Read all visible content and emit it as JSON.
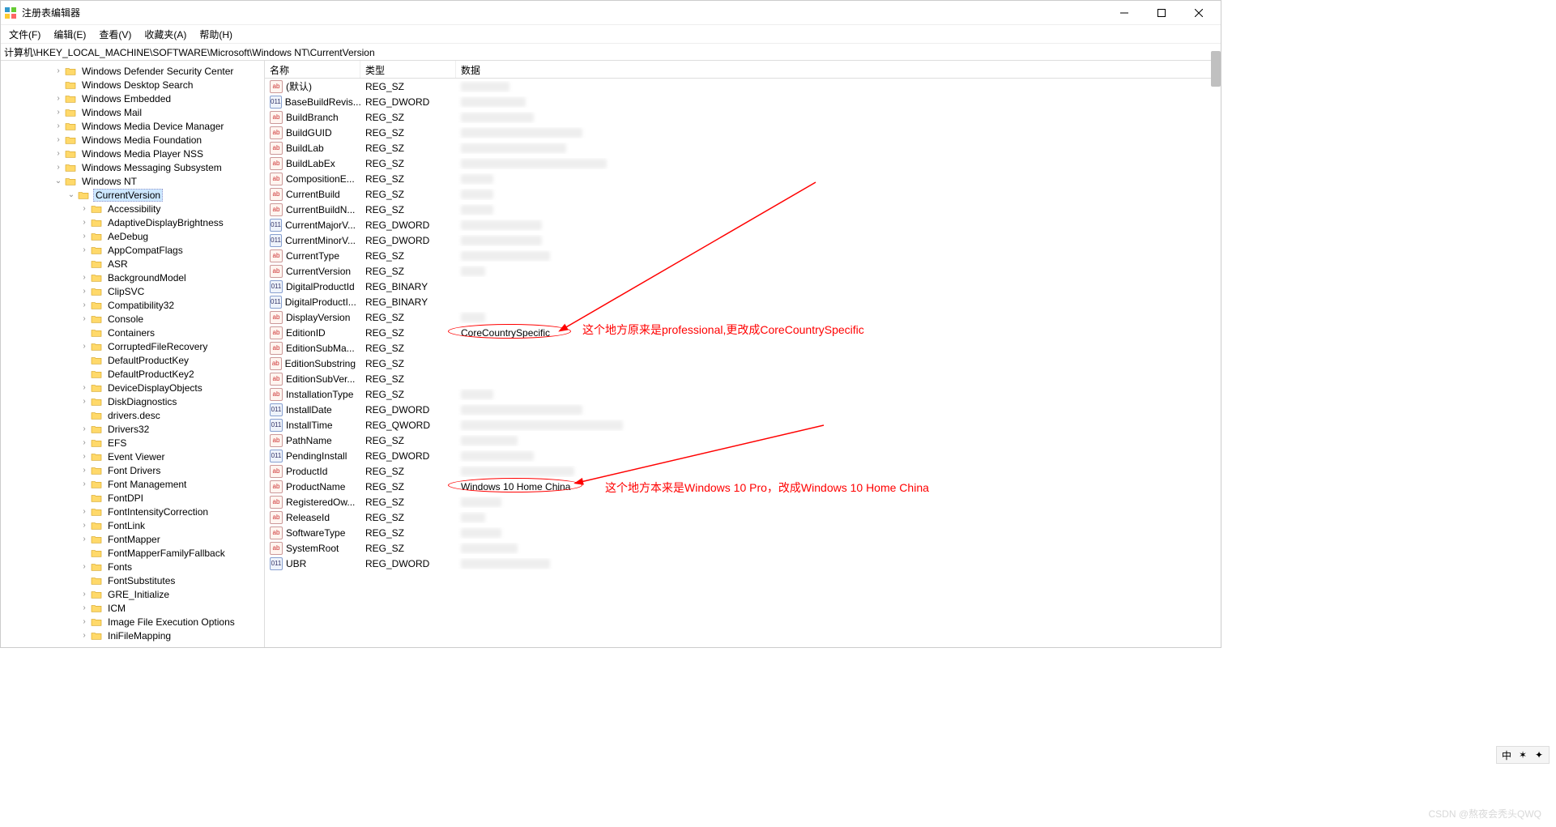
{
  "title": "注册表编辑器",
  "menu": {
    "file": "文件(F)",
    "edit": "编辑(E)",
    "view": "查看(V)",
    "fav": "收藏夹(A)",
    "help": "帮助(H)"
  },
  "address": "计算机\\HKEY_LOCAL_MACHINE\\SOFTWARE\\Microsoft\\Windows NT\\CurrentVersion",
  "list_header": {
    "name": "名称",
    "type": "类型",
    "data": "数据"
  },
  "tree": [
    {
      "indent": 4,
      "chev": ">",
      "label": "Windows Defender Security Center"
    },
    {
      "indent": 4,
      "chev": "",
      "label": "Windows Desktop Search"
    },
    {
      "indent": 4,
      "chev": ">",
      "label": "Windows Embedded"
    },
    {
      "indent": 4,
      "chev": ">",
      "label": "Windows Mail"
    },
    {
      "indent": 4,
      "chev": ">",
      "label": "Windows Media Device Manager"
    },
    {
      "indent": 4,
      "chev": ">",
      "label": "Windows Media Foundation"
    },
    {
      "indent": 4,
      "chev": ">",
      "label": "Windows Media Player NSS"
    },
    {
      "indent": 4,
      "chev": ">",
      "label": "Windows Messaging Subsystem"
    },
    {
      "indent": 4,
      "chev": "v",
      "label": "Windows NT"
    },
    {
      "indent": 5,
      "chev": "v",
      "label": "CurrentVersion",
      "selected": true
    },
    {
      "indent": 6,
      "chev": ">",
      "label": "Accessibility"
    },
    {
      "indent": 6,
      "chev": ">",
      "label": "AdaptiveDisplayBrightness"
    },
    {
      "indent": 6,
      "chev": ">",
      "label": "AeDebug"
    },
    {
      "indent": 6,
      "chev": ">",
      "label": "AppCompatFlags"
    },
    {
      "indent": 6,
      "chev": "",
      "label": "ASR"
    },
    {
      "indent": 6,
      "chev": ">",
      "label": "BackgroundModel"
    },
    {
      "indent": 6,
      "chev": ">",
      "label": "ClipSVC"
    },
    {
      "indent": 6,
      "chev": ">",
      "label": "Compatibility32"
    },
    {
      "indent": 6,
      "chev": ">",
      "label": "Console"
    },
    {
      "indent": 6,
      "chev": "",
      "label": "Containers"
    },
    {
      "indent": 6,
      "chev": ">",
      "label": "CorruptedFileRecovery"
    },
    {
      "indent": 6,
      "chev": "",
      "label": "DefaultProductKey"
    },
    {
      "indent": 6,
      "chev": "",
      "label": "DefaultProductKey2"
    },
    {
      "indent": 6,
      "chev": ">",
      "label": "DeviceDisplayObjects"
    },
    {
      "indent": 6,
      "chev": ">",
      "label": "DiskDiagnostics"
    },
    {
      "indent": 6,
      "chev": "",
      "label": "drivers.desc"
    },
    {
      "indent": 6,
      "chev": ">",
      "label": "Drivers32"
    },
    {
      "indent": 6,
      "chev": ">",
      "label": "EFS"
    },
    {
      "indent": 6,
      "chev": ">",
      "label": "Event Viewer"
    },
    {
      "indent": 6,
      "chev": ">",
      "label": "Font Drivers"
    },
    {
      "indent": 6,
      "chev": ">",
      "label": "Font Management"
    },
    {
      "indent": 6,
      "chev": "",
      "label": "FontDPI"
    },
    {
      "indent": 6,
      "chev": ">",
      "label": "FontIntensityCorrection"
    },
    {
      "indent": 6,
      "chev": ">",
      "label": "FontLink"
    },
    {
      "indent": 6,
      "chev": ">",
      "label": "FontMapper"
    },
    {
      "indent": 6,
      "chev": "",
      "label": "FontMapperFamilyFallback"
    },
    {
      "indent": 6,
      "chev": ">",
      "label": "Fonts"
    },
    {
      "indent": 6,
      "chev": "",
      "label": "FontSubstitutes"
    },
    {
      "indent": 6,
      "chev": ">",
      "label": "GRE_Initialize"
    },
    {
      "indent": 6,
      "chev": ">",
      "label": "ICM"
    },
    {
      "indent": 6,
      "chev": ">",
      "label": "Image File Execution Options"
    },
    {
      "indent": 6,
      "chev": ">",
      "label": "IniFileMapping"
    }
  ],
  "values": [
    {
      "icon": "sz",
      "name": "(默认)",
      "type": "REG_SZ",
      "blur": 60
    },
    {
      "icon": "bin",
      "name": "BaseBuildRevis...",
      "type": "REG_DWORD",
      "blur": 80
    },
    {
      "icon": "sz",
      "name": "BuildBranch",
      "type": "REG_SZ",
      "blur": 90
    },
    {
      "icon": "sz",
      "name": "BuildGUID",
      "type": "REG_SZ",
      "blur": 150
    },
    {
      "icon": "sz",
      "name": "BuildLab",
      "type": "REG_SZ",
      "blur": 130
    },
    {
      "icon": "sz",
      "name": "BuildLabEx",
      "type": "REG_SZ",
      "blur": 180
    },
    {
      "icon": "sz",
      "name": "CompositionE...",
      "type": "REG_SZ",
      "blur": 40
    },
    {
      "icon": "sz",
      "name": "CurrentBuild",
      "type": "REG_SZ",
      "blur": 40
    },
    {
      "icon": "sz",
      "name": "CurrentBuildN...",
      "type": "REG_SZ",
      "blur": 40
    },
    {
      "icon": "bin",
      "name": "CurrentMajorV...",
      "type": "REG_DWORD",
      "blur": 100
    },
    {
      "icon": "bin",
      "name": "CurrentMinorV...",
      "type": "REG_DWORD",
      "blur": 100
    },
    {
      "icon": "sz",
      "name": "CurrentType",
      "type": "REG_SZ",
      "blur": 110
    },
    {
      "icon": "sz",
      "name": "CurrentVersion",
      "type": "REG_SZ",
      "blur": 30
    },
    {
      "icon": "bin",
      "name": "DigitalProductId",
      "type": "REG_BINARY",
      "blur": 0
    },
    {
      "icon": "bin",
      "name": "DigitalProductI...",
      "type": "REG_BINARY",
      "blur": 0
    },
    {
      "icon": "sz",
      "name": "DisplayVersion",
      "type": "REG_SZ",
      "blur": 30
    },
    {
      "icon": "sz",
      "name": "EditionID",
      "type": "REG_SZ",
      "data": "CoreCountrySpecific"
    },
    {
      "icon": "sz",
      "name": "EditionSubMa...",
      "type": "REG_SZ",
      "blur": 0
    },
    {
      "icon": "sz",
      "name": "EditionSubstring",
      "type": "REG_SZ",
      "blur": 0
    },
    {
      "icon": "sz",
      "name": "EditionSubVer...",
      "type": "REG_SZ",
      "blur": 0
    },
    {
      "icon": "sz",
      "name": "InstallationType",
      "type": "REG_SZ",
      "blur": 40
    },
    {
      "icon": "bin",
      "name": "InstallDate",
      "type": "REG_DWORD",
      "blur": 150
    },
    {
      "icon": "bin",
      "name": "InstallTime",
      "type": "REG_QWORD",
      "blur": 200
    },
    {
      "icon": "sz",
      "name": "PathName",
      "type": "REG_SZ",
      "blur": 70
    },
    {
      "icon": "bin",
      "name": "PendingInstall",
      "type": "REG_DWORD",
      "blur": 90
    },
    {
      "icon": "sz",
      "name": "ProductId",
      "type": "REG_SZ",
      "blur": 140
    },
    {
      "icon": "sz",
      "name": "ProductName",
      "type": "REG_SZ",
      "data": "Windows 10 Home China"
    },
    {
      "icon": "sz",
      "name": "RegisteredOw...",
      "type": "REG_SZ",
      "blur": 50
    },
    {
      "icon": "sz",
      "name": "ReleaseId",
      "type": "REG_SZ",
      "blur": 30
    },
    {
      "icon": "sz",
      "name": "SoftwareType",
      "type": "REG_SZ",
      "blur": 50
    },
    {
      "icon": "sz",
      "name": "SystemRoot",
      "type": "REG_SZ",
      "blur": 70
    },
    {
      "icon": "bin",
      "name": "UBR",
      "type": "REG_DWORD",
      "blur": 110
    }
  ],
  "annotations": {
    "text1": "这个地方原来是professional,更改成CoreCountrySpecific",
    "text2": "这个地方本来是Windows 10 Pro，改成Windows 10 Home China"
  },
  "watermark": "CSDN @熬夜会秃头QWQ",
  "ime": "中"
}
